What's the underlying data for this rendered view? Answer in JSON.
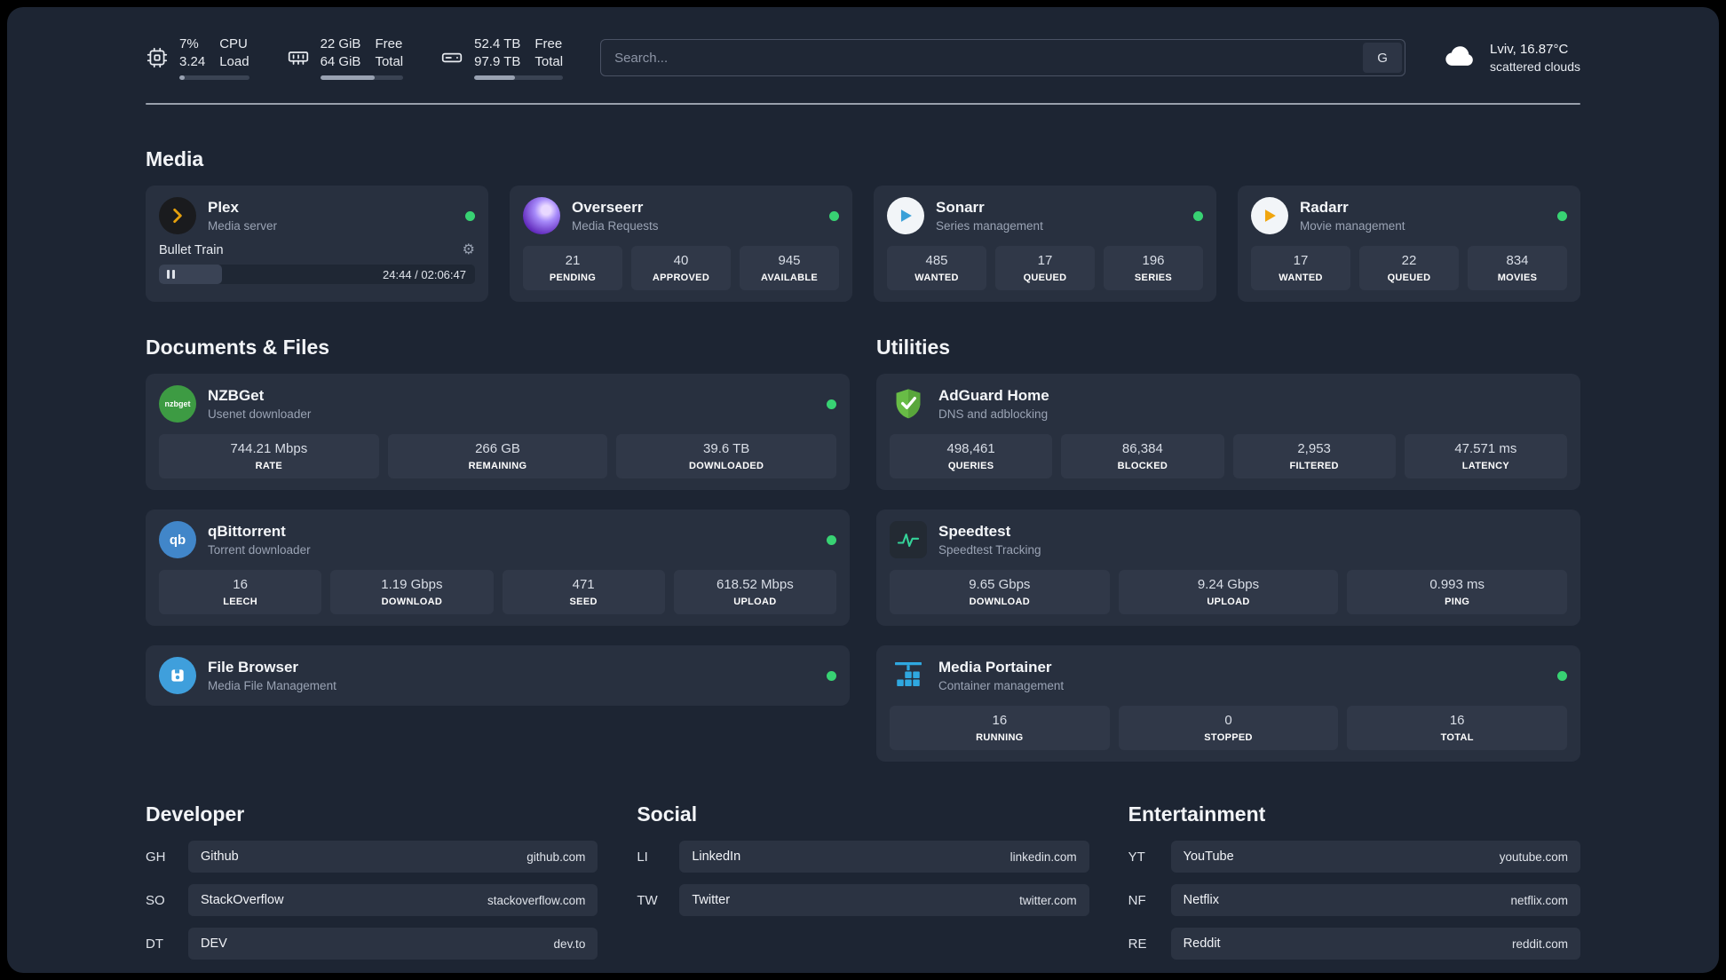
{
  "colors": {
    "status_online": "#38d273",
    "accent_plex": "#e5a00d",
    "accent_green": "#34d399",
    "accent_blue": "#2fa8e0"
  },
  "topbar": {
    "cpu": {
      "value1": "7%",
      "value2": "3.24",
      "label1": "CPU",
      "label2": "Load",
      "bar_percent": 7
    },
    "ram": {
      "value1": "22 GiB",
      "value2": "64 GiB",
      "label1": "Free",
      "label2": "Total",
      "bar_percent": 66
    },
    "disk": {
      "value1": "52.4 TB",
      "value2": "97.9 TB",
      "label1": "Free",
      "label2": "Total",
      "bar_percent": 46
    },
    "search": {
      "placeholder": "Search...",
      "button_label": "G"
    },
    "weather": {
      "location": "Lviv, 16.87°C",
      "condition": "scattered clouds"
    }
  },
  "icons": {
    "qbittorrent_glyph": "qb",
    "nzbget_glyph": "nzbget",
    "gear_glyph": "⚙"
  },
  "sections": {
    "media": {
      "title": "Media",
      "plex": {
        "name": "Plex",
        "description": "Media server",
        "now_playing": {
          "title": "Bullet Train",
          "time": "24:44 / 02:06:47",
          "progress_percent": 20
        }
      },
      "overseerr": {
        "name": "Overseerr",
        "description": "Media Requests",
        "stats": [
          {
            "value": "21",
            "label": "PENDING"
          },
          {
            "value": "40",
            "label": "APPROVED"
          },
          {
            "value": "945",
            "label": "AVAILABLE"
          }
        ]
      },
      "sonarr": {
        "name": "Sonarr",
        "description": "Series management",
        "stats": [
          {
            "value": "485",
            "label": "WANTED"
          },
          {
            "value": "17",
            "label": "QUEUED"
          },
          {
            "value": "196",
            "label": "SERIES"
          }
        ]
      },
      "radarr": {
        "name": "Radarr",
        "description": "Movie management",
        "stats": [
          {
            "value": "17",
            "label": "WANTED"
          },
          {
            "value": "22",
            "label": "QUEUED"
          },
          {
            "value": "834",
            "label": "MOVIES"
          }
        ]
      }
    },
    "documents": {
      "title": "Documents & Files",
      "nzbget": {
        "name": "NZBGet",
        "description": "Usenet downloader",
        "stats": [
          {
            "value": "744.21 Mbps",
            "label": "RATE"
          },
          {
            "value": "266 GB",
            "label": "REMAINING"
          },
          {
            "value": "39.6 TB",
            "label": "DOWNLOADED"
          }
        ]
      },
      "qbittorrent": {
        "name": "qBittorrent",
        "description": "Torrent downloader",
        "stats": [
          {
            "value": "16",
            "label": "LEECH"
          },
          {
            "value": "1.19 Gbps",
            "label": "DOWNLOAD"
          },
          {
            "value": "471",
            "label": "SEED"
          },
          {
            "value": "618.52 Mbps",
            "label": "UPLOAD"
          }
        ]
      },
      "filebrowser": {
        "name": "File Browser",
        "description": "Media File Management"
      }
    },
    "utilities": {
      "title": "Utilities",
      "adguard": {
        "name": "AdGuard Home",
        "description": "DNS and adblocking",
        "stats": [
          {
            "value": "498,461",
            "label": "QUERIES"
          },
          {
            "value": "86,384",
            "label": "BLOCKED"
          },
          {
            "value": "2,953",
            "label": "FILTERED"
          },
          {
            "value": "47.571 ms",
            "label": "LATENCY"
          }
        ]
      },
      "speedtest": {
        "name": "Speedtest",
        "description": "Speedtest Tracking",
        "stats": [
          {
            "value": "9.65 Gbps",
            "label": "DOWNLOAD"
          },
          {
            "value": "9.24 Gbps",
            "label": "UPLOAD"
          },
          {
            "value": "0.993 ms",
            "label": "PING"
          }
        ]
      },
      "portainer": {
        "name": "Media Portainer",
        "description": "Container management",
        "stats": [
          {
            "value": "16",
            "label": "RUNNING"
          },
          {
            "value": "0",
            "label": "STOPPED"
          },
          {
            "value": "16",
            "label": "TOTAL"
          }
        ]
      }
    }
  },
  "bookmarks": {
    "developer": {
      "title": "Developer",
      "links": [
        {
          "abbr": "GH",
          "name": "Github",
          "url": "github.com"
        },
        {
          "abbr": "SO",
          "name": "StackOverflow",
          "url": "stackoverflow.com"
        },
        {
          "abbr": "DT",
          "name": "DEV",
          "url": "dev.to"
        }
      ]
    },
    "social": {
      "title": "Social",
      "links": [
        {
          "abbr": "LI",
          "name": "LinkedIn",
          "url": "linkedin.com"
        },
        {
          "abbr": "TW",
          "name": "Twitter",
          "url": "twitter.com"
        }
      ]
    },
    "entertainment": {
      "title": "Entertainment",
      "links": [
        {
          "abbr": "YT",
          "name": "YouTube",
          "url": "youtube.com"
        },
        {
          "abbr": "NF",
          "name": "Netflix",
          "url": "netflix.com"
        },
        {
          "abbr": "RE",
          "name": "Reddit",
          "url": "reddit.com"
        }
      ]
    }
  }
}
